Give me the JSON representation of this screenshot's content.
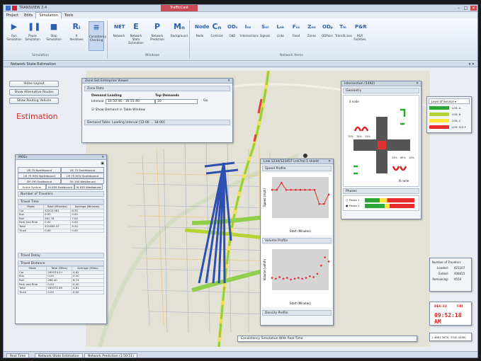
{
  "app": {
    "title": "TRANSVIEW 3.4",
    "title_badge": "TrafficCast"
  },
  "menu": [
    "Project",
    "Edits",
    "Simulation",
    "Tools"
  ],
  "ribbon": {
    "buttons": [
      {
        "icon": "play-icon",
        "label": "Run Simulation",
        "glyph": "▶"
      },
      {
        "icon": "pause-icon",
        "label": "Pause Simulation",
        "glyph": "❚❚"
      },
      {
        "icon": "stop-icon",
        "label": "Stop Simulation",
        "glyph": "■"
      },
      {
        "icon": "counter-icon",
        "label": "# Iterations",
        "glyph": "Rᵢ"
      },
      {
        "icon": "checking-icon",
        "label": "Consistency Checking",
        "glyph": "≡"
      },
      {
        "icon": "network-icon",
        "label": "Network",
        "glyph": "NET"
      },
      {
        "icon": "estimation-icon",
        "label": "Network State Estimation",
        "glyph": "E"
      },
      {
        "icon": "prediction-icon",
        "label": "Network Prediction",
        "glyph": "P"
      },
      {
        "icon": "background-icon",
        "label": "Background",
        "glyph": "Mₙ"
      },
      {
        "icon": "node-icon",
        "label": "Node",
        "glyph": "Node"
      },
      {
        "icon": "centroid-icon",
        "label": "Centroid",
        "glyph": "Cₙ"
      },
      {
        "icon": "odd-icon",
        "label": "OdD",
        "glyph": "ODₛ"
      },
      {
        "icon": "intersection-icon",
        "label": "Intersections",
        "glyph": "Iₙₛ"
      },
      {
        "icon": "signal-icon",
        "label": "Signals",
        "glyph": "Sₙₗ"
      },
      {
        "icon": "links-icon",
        "label": "Links",
        "glyph": "Lₙₖ"
      },
      {
        "icon": "fixed-icon",
        "label": "Fixed",
        "glyph": "Fₓₓ"
      },
      {
        "icon": "zones-icon",
        "label": "Zones",
        "glyph": "Zₙₙ"
      },
      {
        "icon": "odpairs-icon",
        "label": "ODPairs",
        "glyph": "ODₚ"
      },
      {
        "icon": "transitlines-icon",
        "label": "TransitLines",
        "glyph": "Tₗₙ"
      },
      {
        "icon": "pr-icon",
        "label": "P&R Facilities",
        "glyph": "P&R"
      }
    ],
    "groups": [
      "Simulation",
      "Windows",
      "Network Items"
    ]
  },
  "workspace_title": "Network State Estimation",
  "left": {
    "buttons": [
      "Video Layout",
      "Show Alternative Routes",
      "Show Routing Vehicle"
    ],
    "title": "Estimation"
  },
  "moes": {
    "title": "MOEs",
    "tabs": [
      "US 75 Northbound",
      "US 75 Southbound",
      "US 75 HOV Northbound",
      "US 75 HOV Southbound",
      "SH 190 Eastbound",
      "SH 190 Westbound",
      "Entire System",
      "IH 635 Eastbound",
      "IH 635 Westbound"
    ],
    "sections": {
      "travelers": "Number of Travelers",
      "time": "Travel Time",
      "delay": "Travel Delay",
      "distance": "Travel Distance"
    },
    "time_headers": [
      "Mode",
      "Total (Minutes)",
      "Average (Minutes)"
    ],
    "time_rows": [
      [
        "Car",
        "52202.061",
        "8.35"
      ],
      [
        "Bus",
        "0.00",
        "0.00"
      ],
      [
        "Rail",
        "261.78",
        "7.04"
      ],
      [
        "Park and Ride",
        "0.00",
        "0.00"
      ],
      [
        "Total",
        "522695.47",
        "8.34"
      ],
      [
        "Truck",
        "0.00",
        "0.00"
      ]
    ],
    "dist_headers": [
      "Mode",
      "Total (Miles)",
      "Average (Miles)"
    ],
    "dist_rows": [
      [
        "Car",
        "289374.4+",
        "4.82"
      ],
      [
        "Bus",
        "0.00",
        "0.00"
      ],
      [
        "Rail",
        "268.40",
        "6.74"
      ],
      [
        "Park and Ride",
        "0.00",
        "0.00"
      ],
      [
        "Total",
        "289372.69",
        "4.81"
      ],
      [
        "Truck",
        "0.00",
        "0.00"
      ]
    ]
  },
  "zone": {
    "title": "Zone Set Enterprise Viewer",
    "section": "Zone Data",
    "demand_label": "Demand Loading",
    "interval_label": "Interval",
    "interval_value": "16:50:46 - 16:55:46",
    "top_label": "Top Demands",
    "top_value": "10",
    "go_label": "Go",
    "checkbox_label": "Show Demand in Table Window",
    "footer": "Demand Table: Loading Interval [12:00 ... 18:00]"
  },
  "intersection": {
    "title": "Intersection (1492)",
    "section": "Geometry",
    "n_node": "S node",
    "s_node": "N node",
    "labels": [
      "70%",
      "15%",
      "15%",
      "25%",
      "65%",
      "10%"
    ],
    "phases": "Phases",
    "phase_items": [
      "Phase 1",
      "Phase 2"
    ]
  },
  "link": {
    "title": "Link 1234/123457 Lnk7ml 1 shield",
    "speed": "Speed Profile",
    "volume": "Volume Profile",
    "density": "Density Profile",
    "xlabel": "Start (Minutes)",
    "ylabel_speed": "Speed (mph)",
    "ylabel_vol": "Volume (veh/h)"
  },
  "legend": {
    "title": "Level of Service",
    "items": [
      {
        "label": "LOS: A",
        "color": "#2ea836"
      },
      {
        "label": "LOS: B",
        "color": "#b6d334"
      },
      {
        "label": "LOS: C",
        "color": "#ffe53a"
      },
      {
        "label": "LOS: D,E,F",
        "color": "#e82a2a"
      }
    ]
  },
  "travelers": {
    "title": "Number of Travelers",
    "rows": [
      [
        "Loaded:",
        "421107"
      ],
      [
        "Exited:",
        "408415"
      ],
      [
        "Remaining:",
        "4554"
      ]
    ]
  },
  "clock": {
    "date": "DEC 23",
    "day": "FRI",
    "time": "09:52:18 AM"
  },
  "coords": "(-4881.3676, 3340.4446)",
  "consistency": "Consistency Simulation With Real-Time",
  "taskbar": [
    "Real Time",
    "Network State Estimation",
    "Network Prediction (3:50:51)"
  ],
  "chart_data": [
    {
      "type": "line",
      "title": "Speed Profile",
      "xlabel": "Start (Minutes)",
      "ylabel": "Speed (mph)",
      "x": [
        0,
        5,
        10,
        15,
        20,
        25,
        30,
        35,
        40,
        45,
        50,
        55,
        60
      ],
      "values": [
        48,
        48,
        60,
        48,
        48,
        48,
        48,
        48,
        48,
        48,
        24,
        24,
        40
      ],
      "ylim": [
        0,
        70
      ]
    },
    {
      "type": "scatter",
      "title": "Volume Profile",
      "xlabel": "Start (Minutes)",
      "ylabel": "Volume (veh/h)",
      "x": [
        0,
        4,
        8,
        12,
        16,
        20,
        24,
        28,
        32,
        36,
        40,
        44,
        48,
        52,
        56,
        60
      ],
      "values": [
        30,
        28,
        32,
        28,
        30,
        26,
        28,
        30,
        28,
        30,
        34,
        32,
        40,
        60,
        80,
        70
      ],
      "ylim": [
        0,
        100
      ]
    }
  ]
}
